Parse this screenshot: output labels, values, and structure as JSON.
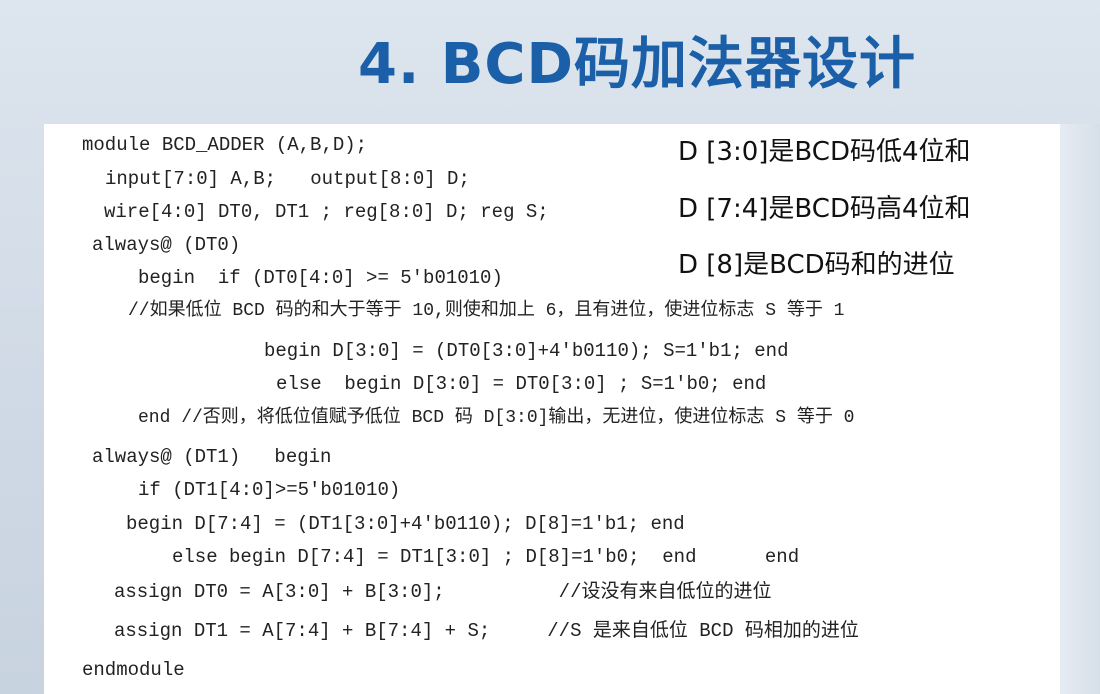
{
  "slide": {
    "title": "4. BCD码加法器设计"
  },
  "notes": [
    "D [3:0]是BCD码低4位和",
    "D [7:4]是BCD码高4位和",
    "D [8]是BCD码和的进位"
  ],
  "code_lines": [
    "module BCD_ADDER (A,B,D);",
    "input[7:0] A,B;   output[8:0] D;",
    "wire[4:0] DT0, DT1 ; reg[8:0] D; reg S;",
    "always@ (DT0)",
    "begin  if (DT0[4:0] >= 5'b01010)",
    "//如果低位 BCD 码的和大于等于 10,则使和加上 6，且有进位，使进位标志 S 等于 1",
    "begin D[3:0] = (DT0[3:0]+4'b0110); S=1'b1; end",
    "else  begin D[3:0] = DT0[3:0] ; S=1'b0; end",
    "end //否则，将低位值赋予低位 BCD 码 D[3:0]输出，无进位，使进位标志 S 等于 0",
    "always@ (DT1)   begin",
    "if (DT1[4:0]>=5'b01010)",
    "begin D[7:4] = (DT1[3:0]+4'b0110); D[8]=1'b1; end",
    "else begin D[7:4] = DT1[3:0] ; D[8]=1'b0;  end      end",
    "assign DT0 = A[3:0] + B[3:0];          //设没有来自低位的进位",
    "assign DT1 = A[7:4] + B[7:4] + S;     //S 是来自低位 BCD 码相加的进位",
    "endmodule"
  ]
}
